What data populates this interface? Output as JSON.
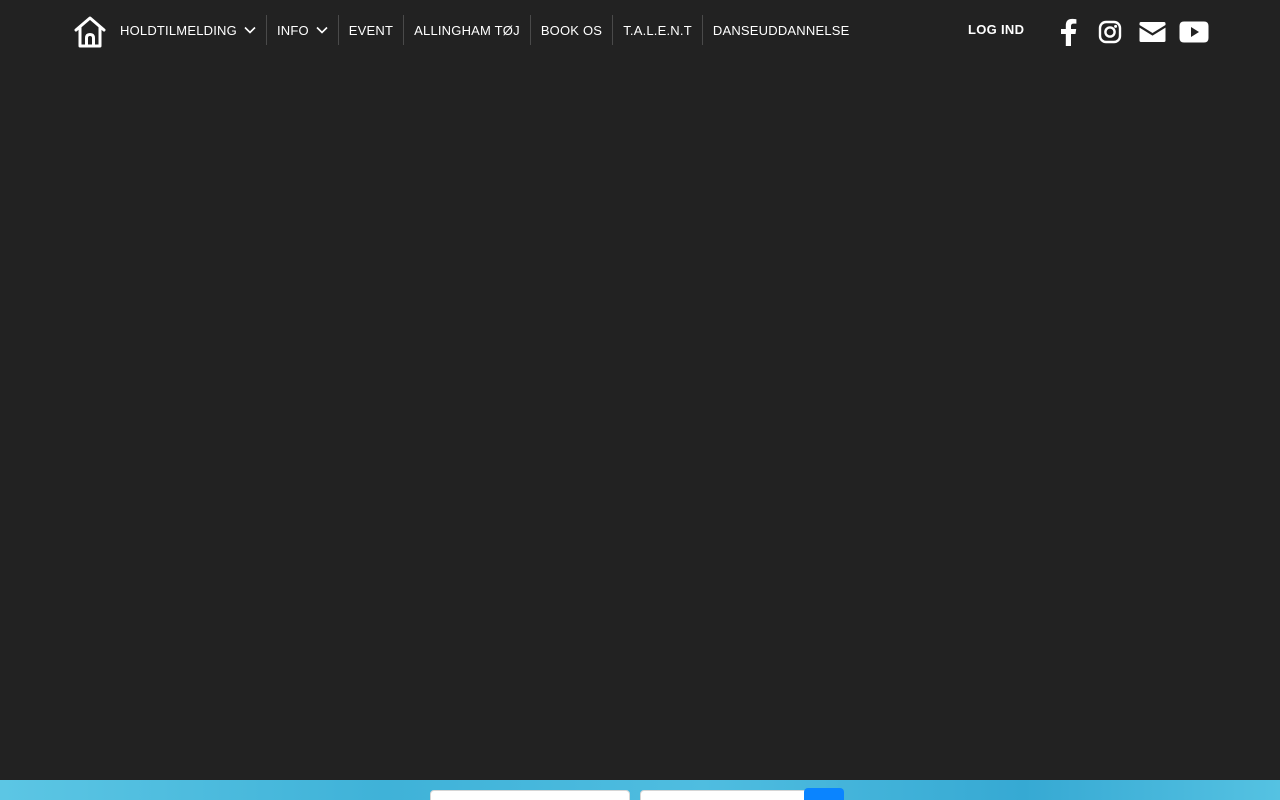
{
  "nav": {
    "home_icon": "home-icon",
    "items": [
      {
        "label": "HOLDTILMELDING",
        "has_dropdown": true
      },
      {
        "label": "INFO",
        "has_dropdown": true
      },
      {
        "label": "EVENT",
        "has_dropdown": false
      },
      {
        "label": "ALLINGHAM TØJ",
        "has_dropdown": false
      },
      {
        "label": "BOOK OS",
        "has_dropdown": false
      },
      {
        "label": "T.A.L.E.N.T",
        "has_dropdown": false
      },
      {
        "label": "DANSEUDDANNELSE",
        "has_dropdown": false
      }
    ],
    "login_label": "LOG IND",
    "social": [
      {
        "name": "facebook-icon"
      },
      {
        "name": "instagram-icon"
      },
      {
        "name": "envelope-icon"
      },
      {
        "name": "youtube-icon"
      }
    ]
  },
  "colors": {
    "background": "#222222",
    "nav_text": "#ffffff",
    "footer_accent": "#3fb2d8",
    "button_blue": "#0a84ff"
  },
  "footer_form": {
    "first_value": "",
    "second_value": ""
  }
}
